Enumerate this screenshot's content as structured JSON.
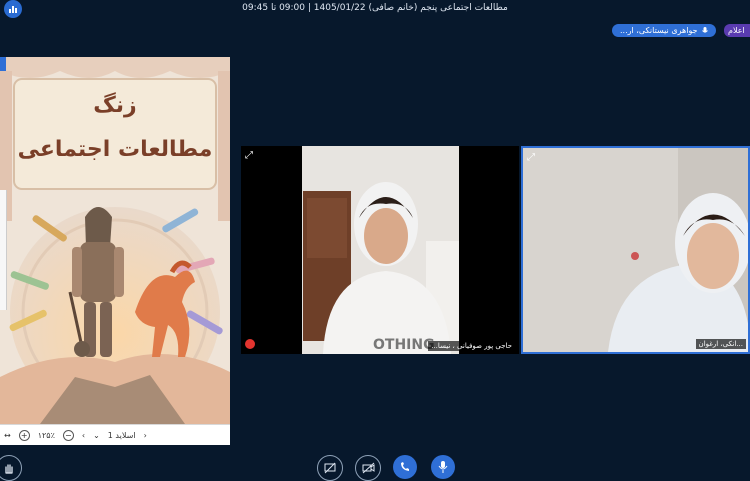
{
  "topbar": {
    "title": "مطالعات اجتماعی پنجم (خانم صافی) 1405/01/22 | 09:00 تا 09:45"
  },
  "speaker": {
    "label": "جواهری نیستانکی، ار...",
    "tag": "اعلام"
  },
  "slide": {
    "title_line1": "زنگ",
    "title_line2": "مطالعات اجتماعی",
    "toolbar": {
      "slide_label": "اسلاید 1",
      "zoom": "۱۲۵٪"
    }
  },
  "videos": [
    {
      "name": "حاجی پور صوفیانی ، نیسا..."
    },
    {
      "name": "...انکی، ارغوان"
    }
  ],
  "colors": {
    "background": "#07182c",
    "accent": "#2f6fd6",
    "purple": "#5a3bb0"
  },
  "bottom_controls": [
    "hand-raise",
    "screen-share",
    "camera-off",
    "phone",
    "microphone"
  ]
}
